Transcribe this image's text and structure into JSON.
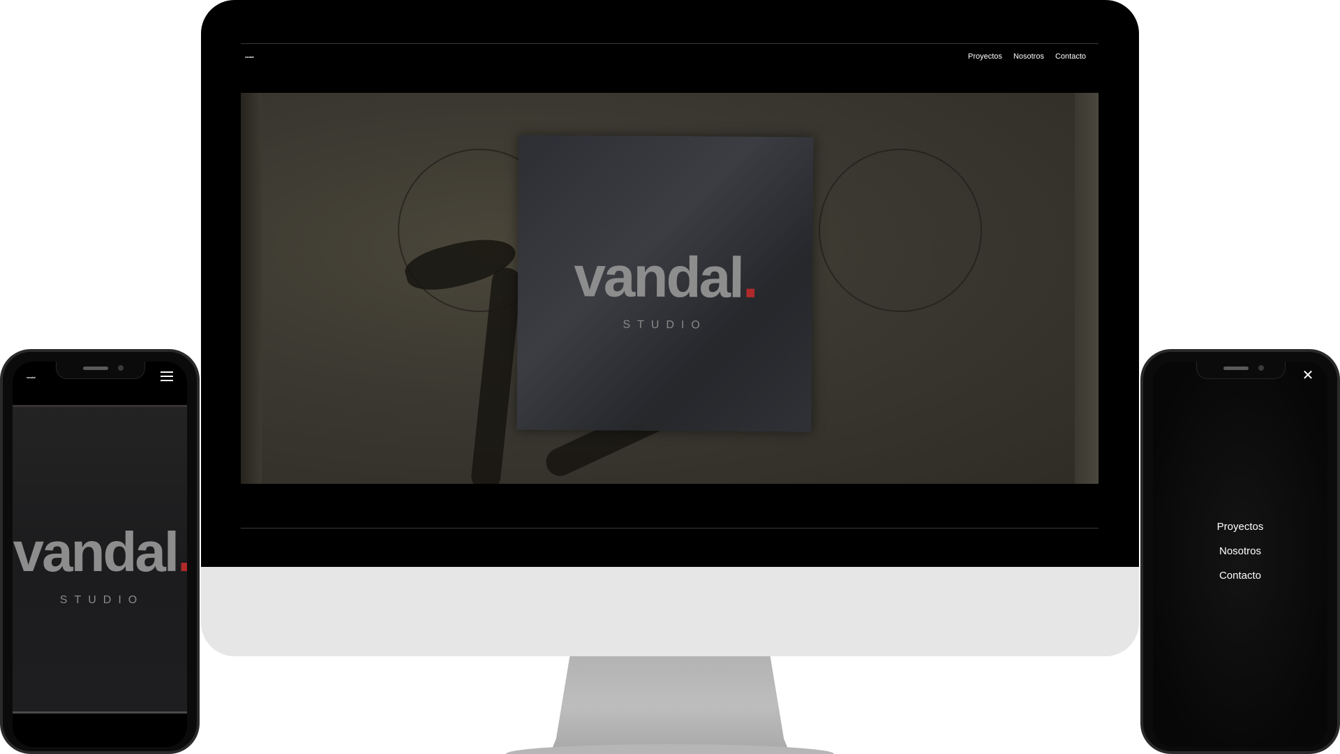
{
  "desktop": {
    "logo_small": "vandal",
    "nav": [
      "Proyectos",
      "Nosotros",
      "Contacto"
    ],
    "hero": {
      "brand_word": "vandal",
      "brand_dot": ".",
      "brand_sub": "STUDIO"
    }
  },
  "mobile_home": {
    "logo_small": "vandal",
    "hero": {
      "brand_word": "vandal",
      "brand_dot": ".",
      "brand_sub": "STUDIO"
    },
    "menu_icon": "hamburger-menu-icon"
  },
  "mobile_menu": {
    "close_icon": "close-icon",
    "items": [
      "Proyectos",
      "Nosotros",
      "Contacto"
    ]
  },
  "colors": {
    "background": "#ffffff",
    "bezel": "#000000",
    "chin": "#e6e6e6",
    "stand": "#b3b3b3",
    "brand_gray": "#8d8d8d",
    "brand_red": "#b02a2a"
  }
}
